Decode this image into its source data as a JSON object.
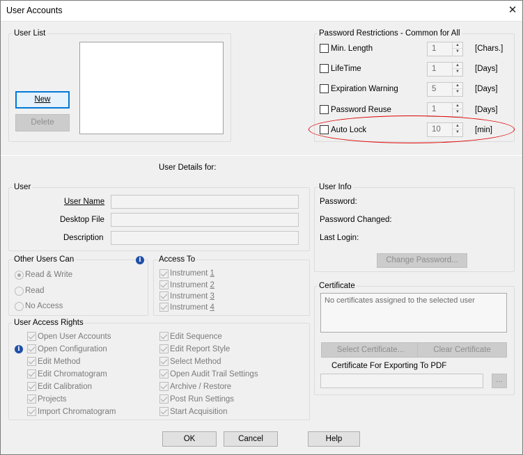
{
  "window": {
    "title": "User Accounts",
    "close_glyph": "✕"
  },
  "user_list": {
    "legend": "User List",
    "new_button": "New",
    "delete_button": "Delete"
  },
  "password_restrictions": {
    "legend": "Password Restrictions - Common for All",
    "rows": [
      {
        "label": "Min. Length",
        "value": "1",
        "unit": "[Chars.]"
      },
      {
        "label": "LifeTime",
        "value": "1",
        "unit": "[Days]"
      },
      {
        "label": "Expiration Warning",
        "value": "5",
        "unit": "[Days]"
      },
      {
        "label": "Password Reuse",
        "value": "1",
        "unit": "[Days]"
      },
      {
        "label": "Auto Lock",
        "value": "10",
        "unit": "[min]"
      }
    ],
    "highlight_color": "#e00000"
  },
  "user_details_heading": "User Details for:",
  "user": {
    "legend": "User",
    "user_name_label": "User Name",
    "desktop_file_label": "Desktop File",
    "description_label": "Description"
  },
  "user_info": {
    "legend": "User Info",
    "password_label": "Password:",
    "password_changed_label": "Password Changed:",
    "last_login_label": "Last Login:",
    "change_password_button": "Change Password..."
  },
  "other_users": {
    "legend": "Other Users Can",
    "options": [
      "Read & Write",
      "Read",
      "No Access"
    ],
    "selected": "Read & Write"
  },
  "access_to": {
    "legend": "Access To",
    "items": [
      {
        "label": "Instrument",
        "num": "1"
      },
      {
        "label": "Instrument",
        "num": "2"
      },
      {
        "label": "Instrument",
        "num": "3"
      },
      {
        "label": "Instrument",
        "num": "4"
      }
    ]
  },
  "access_rights": {
    "legend": "User Access Rights",
    "left": [
      "Open User Accounts",
      "Open Configuration",
      "Edit Method",
      "Edit Chromatogram",
      "Edit Calibration",
      "Projects",
      "Import Chromatogram"
    ],
    "right": [
      "Edit Sequence",
      "Edit Report Style",
      "Select Method",
      "Open Audit Trail Settings",
      "Archive / Restore",
      "Post Run Settings",
      "Start Acquisition"
    ]
  },
  "certificate": {
    "legend": "Certificate",
    "empty_text": "No certificates assigned to the selected user",
    "select_button": "Select Certificate...",
    "clear_button": "Clear Certificate",
    "export_label": "Certificate For Exporting To PDF",
    "browse_button": "..."
  },
  "footer": {
    "ok": "OK",
    "cancel": "Cancel",
    "help": "Help"
  }
}
